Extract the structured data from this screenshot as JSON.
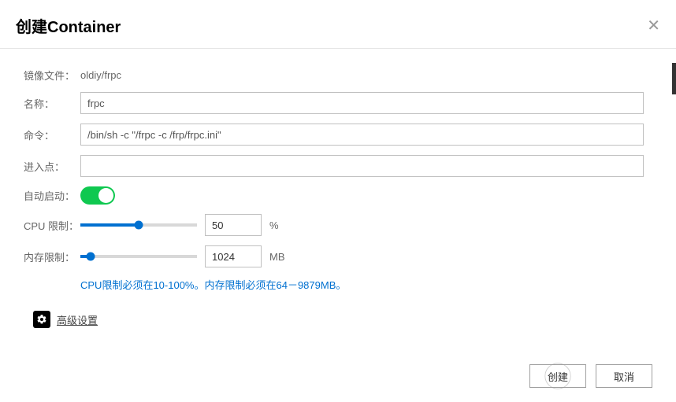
{
  "header": {
    "title": "创建Container"
  },
  "labels": {
    "image": "镜像文件：",
    "name": "名称：",
    "command": "命令：",
    "entrypoint": "进入点：",
    "autostart": "自动启动：",
    "cpu": "CPU 限制：",
    "memory": "内存限制："
  },
  "values": {
    "image": "oldiy/frpc",
    "name": "frpc",
    "command": "/bin/sh -c \"/frpc -c /frp/frpc.ini\"",
    "entrypoint": "",
    "cpu": "50",
    "cpu_unit": "%",
    "cpu_slider_pct": 50,
    "memory": "1024",
    "memory_unit": "MB",
    "memory_slider_pct": 9
  },
  "hint": "CPU限制必须在10-100%。内存限制必须在64－9879MB。",
  "advanced": "高级设置",
  "footer": {
    "ok": "创建",
    "cancel": "取消"
  }
}
